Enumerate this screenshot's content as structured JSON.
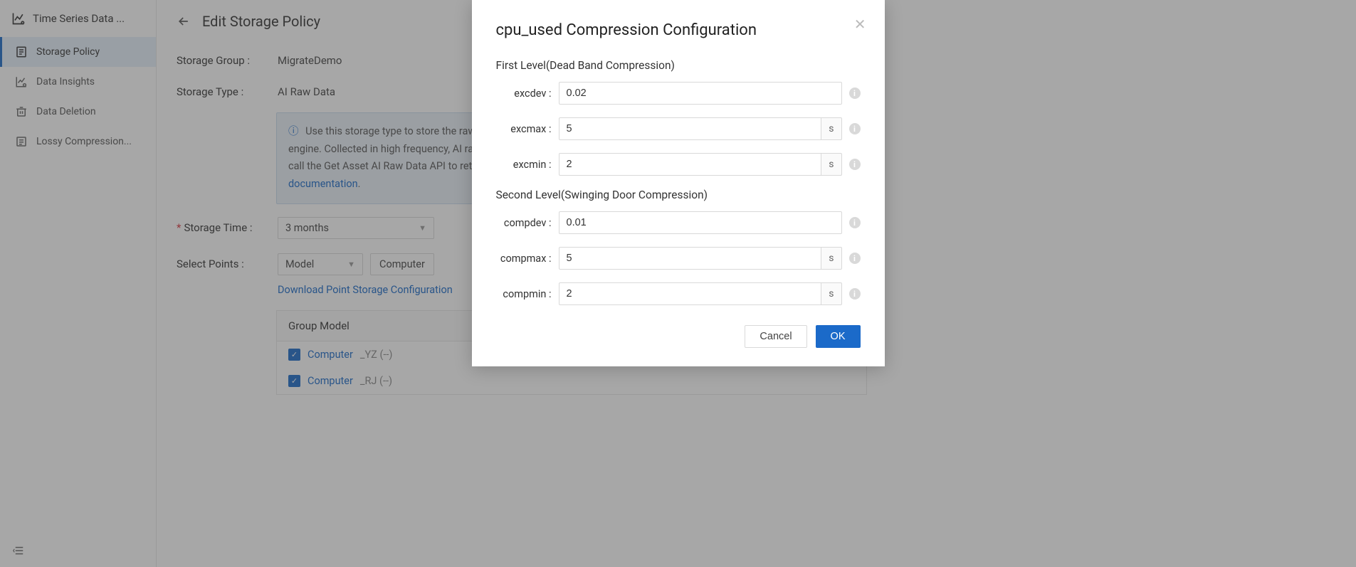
{
  "sidebar": {
    "title": "Time Series Data ...",
    "items": [
      {
        "label": "Storage Policy",
        "icon": "policy-icon",
        "active": true
      },
      {
        "label": "Data Insights",
        "icon": "insights-icon",
        "active": false
      },
      {
        "label": "Data Deletion",
        "icon": "deletion-icon",
        "active": false
      },
      {
        "label": "Lossy Compression...",
        "icon": "compression-icon",
        "active": false
      }
    ]
  },
  "page": {
    "title": "Edit Storage Policy",
    "storage_group_label": "Storage Group :",
    "storage_group_value": "MigrateDemo",
    "storage_type_label": "Storage Type :",
    "storage_type_value": "AI Raw Data",
    "info_text_1": "Use this storage type to store the raw data uploaded by measurement points and data processed by the streaming engine. Collected in high frequency, AI raw data is generally stored for business analysis in short periods of time. You can call the Get Asset AI Raw Data API to retrieve the stored data of measurement points. For detailed information, view the ",
    "info_api_link": "API documentation",
    "storage_time_label": "Storage Time :",
    "storage_time_value": "3 months",
    "select_points_label": "Select Points :",
    "model_select_value": "Model",
    "breadcrumb_value": "Computer",
    "download_link": "Download Point Storage Configuration",
    "group_model_header": "Group Model",
    "points": [
      {
        "name": "Computer",
        "suffix": "_YZ (--)"
      },
      {
        "name": "Computer",
        "suffix": "_RJ (--)"
      }
    ]
  },
  "modal": {
    "title": "cpu_used Compression Configuration",
    "section1": "First Level(Dead Band Compression)",
    "section2": "Second Level(Swinging Door Compression)",
    "fields": {
      "excdev": {
        "label": "excdev :",
        "value": "0.02",
        "unit": null
      },
      "excmax": {
        "label": "excmax :",
        "value": "5",
        "unit": "s"
      },
      "excmin": {
        "label": "excmin :",
        "value": "2",
        "unit": "s"
      },
      "compdev": {
        "label": "compdev :",
        "value": "0.01",
        "unit": null
      },
      "compmax": {
        "label": "compmax :",
        "value": "5",
        "unit": "s"
      },
      "compmin": {
        "label": "compmin :",
        "value": "2",
        "unit": "s"
      }
    },
    "cancel_label": "Cancel",
    "ok_label": "OK"
  }
}
